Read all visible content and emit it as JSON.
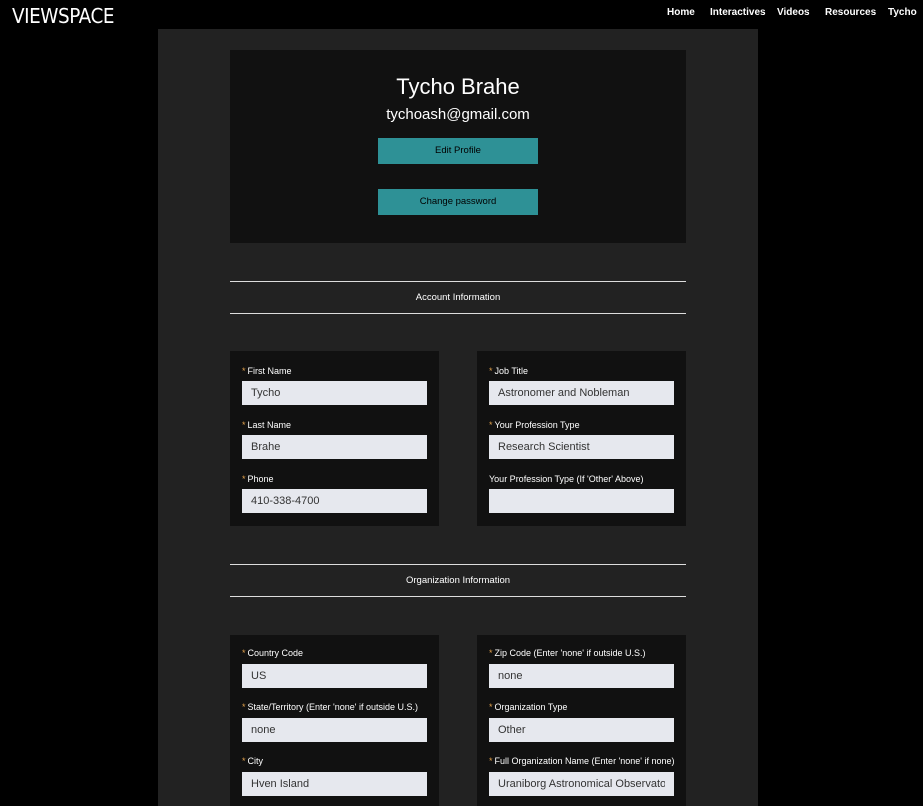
{
  "header": {
    "logo": "VIEWSPACE",
    "nav": [
      {
        "label": "Home"
      },
      {
        "label": "Interactives"
      },
      {
        "label": "Videos"
      },
      {
        "label": "Resources"
      },
      {
        "label": "Tycho"
      }
    ]
  },
  "profile": {
    "name": "Tycho Brahe",
    "email": "tychoash@gmail.com",
    "edit_label": "Edit Profile",
    "change_password_label": "Change password"
  },
  "sections": {
    "account": "Account Information",
    "organization": "Organization Information"
  },
  "required_marker": "*",
  "account": {
    "first_name": {
      "label": "First Name",
      "value": "Tycho"
    },
    "last_name": {
      "label": "Last Name",
      "value": "Brahe"
    },
    "phone": {
      "label": "Phone",
      "value": "410-338-4700"
    },
    "job_title": {
      "label": "Job Title",
      "value": "Astronomer and Nobleman"
    },
    "profession_type": {
      "label": "Your Profession Type",
      "value": "Research Scientist"
    },
    "profession_other": {
      "label": "Your Profession Type (If 'Other' Above)",
      "value": ""
    }
  },
  "organization": {
    "country_code": {
      "label": "Country Code",
      "value": "US"
    },
    "state": {
      "label": "State/Territory (Enter 'none' if outside U.S.)",
      "value": "none"
    },
    "city": {
      "label": "City",
      "value": "Hven Island"
    },
    "zip": {
      "label": "Zip Code (Enter 'none' if outside U.S.)",
      "value": "none"
    },
    "org_type": {
      "label": "Organization Type",
      "value": "Other"
    },
    "org_name": {
      "label": "Full Organization Name (Enter 'none' if none)",
      "value": "Uraniborg Astronomical Observatory"
    }
  },
  "colors": {
    "accent": "#2e9196",
    "required": "#e0a04b",
    "input_bg": "#e6e8ee"
  }
}
